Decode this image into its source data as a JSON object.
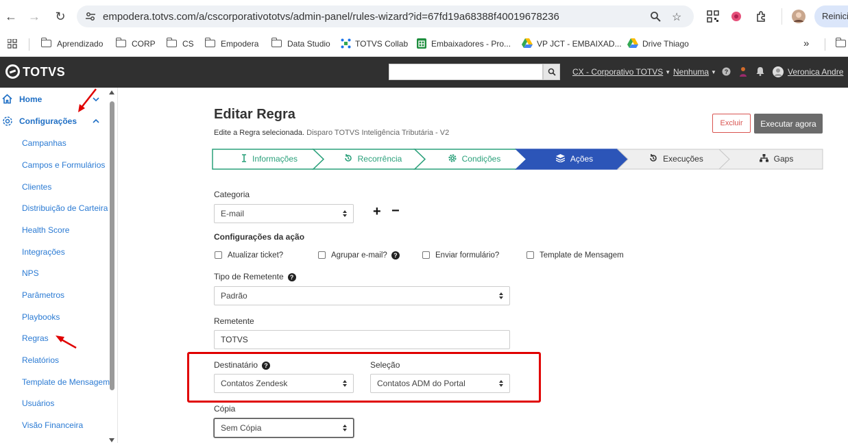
{
  "browser": {
    "url": "empodera.totvs.com/a/cscorporativototvs/admin-panel/rules-wizard?id=67fd19a68388f40019678236",
    "restart_label": "Reiniciar"
  },
  "bookmarks": [
    "Aprendizado",
    "CORP",
    "CS",
    "Empodera",
    "Data Studio",
    "TOTVS Collab",
    "Embaixadores - Pro...",
    "VP JCT - EMBAIXAD...",
    "Drive Thiago"
  ],
  "header": {
    "logo": "TOTVS",
    "org": "CX - Corporativo TOTVS",
    "filter": "Nenhuma",
    "user": "Veronica Andre"
  },
  "sidebar": {
    "home": "Home",
    "configuracoes": "Configurações",
    "items": [
      "Campanhas",
      "Campos e Formulários",
      "Clientes",
      "Distribuição de Carteira",
      "Health Score",
      "Integrações",
      "NPS",
      "Parâmetros",
      "Playbooks",
      "Regras",
      "Relatórios",
      "Template de Mensagem",
      "Usuários",
      "Visão Financeira"
    ]
  },
  "main": {
    "title": "Editar Regra",
    "subtitle": "Edite a Regra selecionada.",
    "rule_name": "Disparo TOTVS Inteligência Tributária - V2",
    "delete_label": "Excluir",
    "run_label": "Executar agora",
    "steps": [
      {
        "label": "Informações",
        "state": "done",
        "icon": "info-icon"
      },
      {
        "label": "Recorrência",
        "state": "done",
        "icon": "history-icon"
      },
      {
        "label": "Condições",
        "state": "done",
        "icon": "gear-icon"
      },
      {
        "label": "Ações",
        "state": "active",
        "icon": "layers-icon"
      },
      {
        "label": "Execuções",
        "state": "pending",
        "icon": "history-icon"
      },
      {
        "label": "Gaps",
        "state": "pending",
        "icon": "sitemap-icon"
      }
    ],
    "categoria_label": "Categoria",
    "categoria_value": "E-mail",
    "plus": "+",
    "minus": "−",
    "config_label": "Configurações da ação",
    "checks": [
      "Atualizar ticket?",
      "Agrupar e-mail?",
      "Enviar formulário?",
      "Template de Mensagem"
    ],
    "tipo_remetente_label": "Tipo de Remetente",
    "tipo_remetente_value": "Padrão",
    "remetente_label": "Remetente",
    "remetente_value": "TOTVS",
    "destinatario_label": "Destinatário",
    "destinatario_value": "Contatos Zendesk",
    "selecao_label": "Seleção",
    "selecao_value": "Contatos ADM do Portal",
    "copia_label": "Cópia",
    "copia_value": "Sem Cópia"
  },
  "colors": {
    "active_step": "#2c55b8",
    "done_step": "#2aa07a",
    "annotation": "#e00000",
    "link": "#1f6fc5"
  }
}
